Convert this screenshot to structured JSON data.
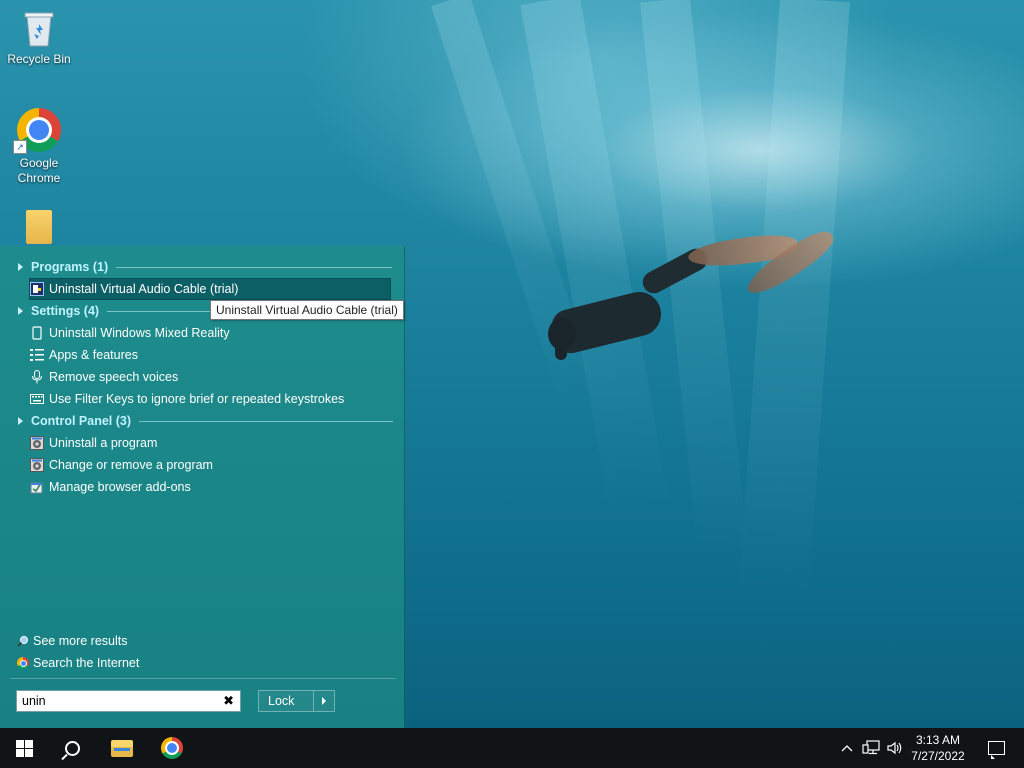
{
  "desktop": {
    "icons": [
      {
        "label": "Recycle Bin",
        "icon": "recycle-bin-icon"
      },
      {
        "label": "Google\nChrome",
        "icon": "chrome-icon"
      },
      {
        "label": "",
        "icon": "folder-icon"
      }
    ]
  },
  "start_menu": {
    "groups": {
      "programs": {
        "header": "Programs (1)"
      },
      "settings": {
        "header": "Settings (4)"
      },
      "control_panel": {
        "header": "Control Panel (3)"
      }
    },
    "programs": [
      {
        "label": "Uninstall Virtual Audio Cable (trial)",
        "icon": "program-icon",
        "selected": true
      }
    ],
    "settings": [
      {
        "label": "Uninstall Windows Mixed Reality",
        "icon": "phone-icon"
      },
      {
        "label": "Apps & features",
        "icon": "list-icon"
      },
      {
        "label": "Remove speech voices",
        "icon": "microphone-icon"
      },
      {
        "label": "Use Filter Keys to ignore brief or repeated keystrokes",
        "icon": "keyboard-icon"
      }
    ],
    "control_panel": [
      {
        "label": "Uninstall a program",
        "icon": "programs-features-icon"
      },
      {
        "label": "Change or remove a program",
        "icon": "programs-features-icon"
      },
      {
        "label": "Manage browser add-ons",
        "icon": "addons-icon"
      }
    ],
    "tooltip": "Uninstall Virtual Audio Cable (trial)",
    "see_more": "See more results",
    "search_internet": "Search the Internet",
    "search": {
      "value": "unin",
      "clear_glyph": "✖"
    },
    "lock_label": "Lock"
  },
  "taskbar": {
    "time": "3:13 AM",
    "date": "7/27/2022",
    "tray_chevron": "^"
  },
  "colors": {
    "accent": "#1d8a8c",
    "group_header": "#bff3ff",
    "taskbar": "#101417"
  }
}
